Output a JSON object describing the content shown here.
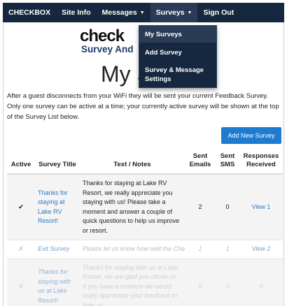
{
  "nav": {
    "brand": "CHECKBOX",
    "site_info": "Site Info",
    "messages": "Messages",
    "surveys": "Surveys",
    "sign_out": "Sign Out"
  },
  "dropdown": {
    "items": [
      {
        "label": "My Surveys"
      },
      {
        "label": "Add Survey"
      },
      {
        "label": "Survey & Message Settings"
      }
    ]
  },
  "logo": {
    "top": "check",
    "sub": "Survey And"
  },
  "heading": "My S",
  "intro": "After a guest disconnects from your WiFi they will be sent your current Feedback Survey. Only one survey can be active at a time; your currently active survey will be shown at the top of the Survey List below.",
  "add_button": "Add New Survey",
  "table": {
    "headers": {
      "active": "Active",
      "title": "Survey Title",
      "notes": "Text / Notes",
      "emails": "Sent Emails",
      "sms": "Sent SMS",
      "responses": "Responses Received"
    },
    "rows": [
      {
        "active": "✔",
        "title": "Thanks for staying at Lake RV Resort!",
        "notes": "Thanks for staying at Lake RV Resort, we really appreciate you staying with us! Please take a moment and answer a couple of quick questions to help us improve or resort.",
        "emails": "2",
        "sms": "0",
        "responses": "View 1"
      },
      {
        "active": "✗",
        "title": "Exit Survey",
        "notes": "Please let us know how well the Checkbox WiFi worked for you.",
        "emails": "1",
        "sms": "1",
        "responses": "View 2"
      },
      {
        "active": "✗",
        "title": "Thanks for staying with us at Lake Resort!",
        "notes": "Thanks for staying with us at Lake Resort, we are glad you chose us. If you have a moment we would really appreciate your feedback to help us",
        "emails": "0",
        "sms": "0",
        "responses": "0"
      }
    ]
  }
}
